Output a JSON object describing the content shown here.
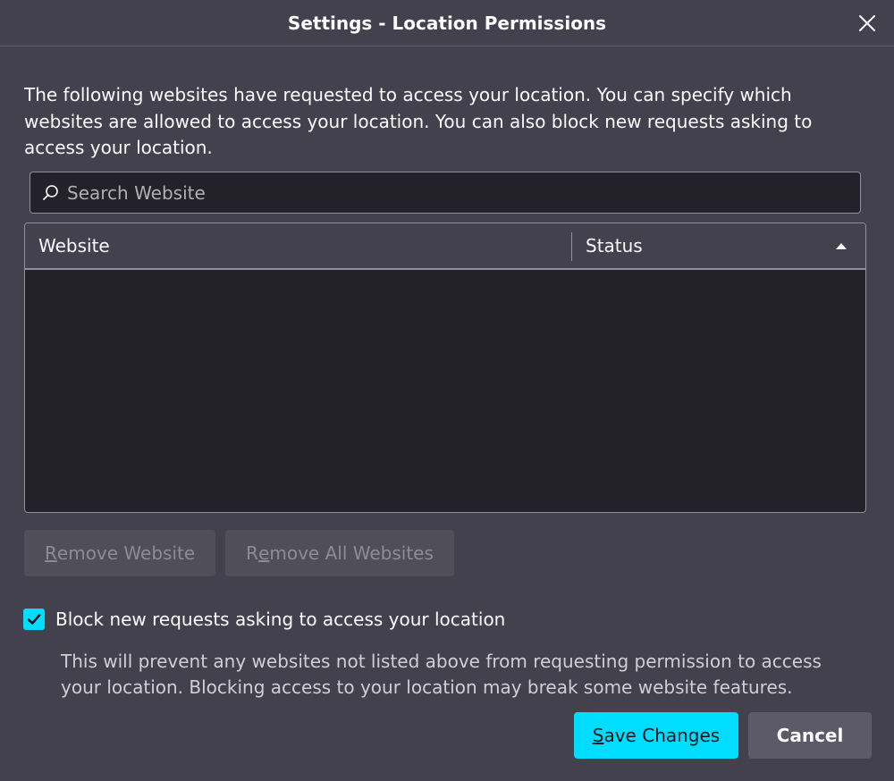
{
  "window": {
    "title": "Settings - Location Permissions"
  },
  "description": "The following websites have requested to access your location. You can specify which websites are allowed to access your location. You can also block new requests asking to access your location.",
  "search": {
    "placeholder": "Search Website",
    "value": ""
  },
  "table": {
    "columns": [
      "Website",
      "Status"
    ],
    "sort": "ascending",
    "rows": []
  },
  "buttons": {
    "remove_website": {
      "accesskey": "R",
      "rest": "emove Website"
    },
    "remove_all_websites": {
      "prefix": "R",
      "accesskey": "e",
      "rest": "move All Websites"
    },
    "save_changes": {
      "accesskey": "S",
      "rest": "ave Changes"
    },
    "cancel": "Cancel"
  },
  "block_option": {
    "checked": true,
    "label": "Block new requests asking to access your location",
    "hint": "This will prevent any websites not listed above from requesting permission to access your location. Blocking access to your location may break some website features."
  },
  "colors": {
    "accent": "#00ddff",
    "background": "#42414d",
    "field": "#23222b"
  },
  "icons": {
    "close": "close-icon",
    "search": "search-icon",
    "sort": "sort-ascending-icon",
    "check": "checkmark-icon"
  }
}
